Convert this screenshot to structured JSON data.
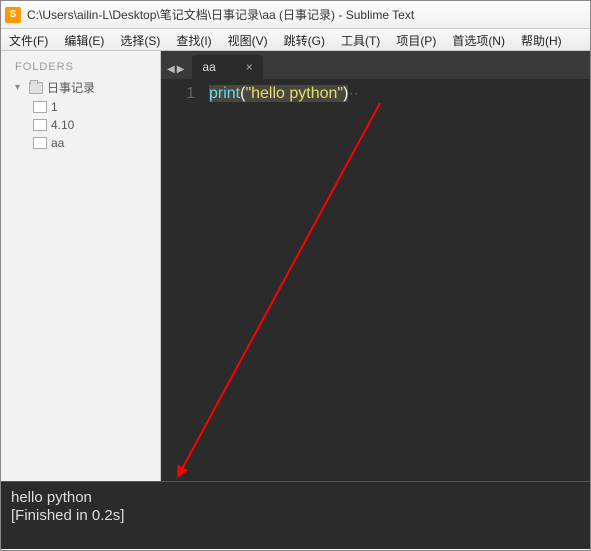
{
  "window": {
    "title": "C:\\Users\\ailin-L\\Desktop\\笔记文档\\日事记录\\aa (日事记录) - Sublime Text"
  },
  "menu": {
    "items": [
      "文件(F)",
      "编辑(E)",
      "选择(S)",
      "查找(I)",
      "视图(V)",
      "跳转(G)",
      "工具(T)",
      "项目(P)",
      "首选项(N)",
      "帮助(H)"
    ]
  },
  "sidebar": {
    "header": "FOLDERS",
    "root": {
      "label": "日事记录",
      "expanded": "▾"
    },
    "items": [
      {
        "label": "1"
      },
      {
        "label": "4.10"
      },
      {
        "label": "aa"
      }
    ]
  },
  "tabs": {
    "nav_prev": "◀",
    "nav_next": "▶",
    "list": [
      {
        "label": "aa",
        "close": "×",
        "active": true
      }
    ]
  },
  "editor": {
    "line_number": "1",
    "code_tokens": {
      "fn": "print",
      "open": "(",
      "str": "\"hello python\"",
      "close": ")"
    }
  },
  "console": {
    "line1": "hello python",
    "line2": "[Finished in 0.2s]"
  }
}
